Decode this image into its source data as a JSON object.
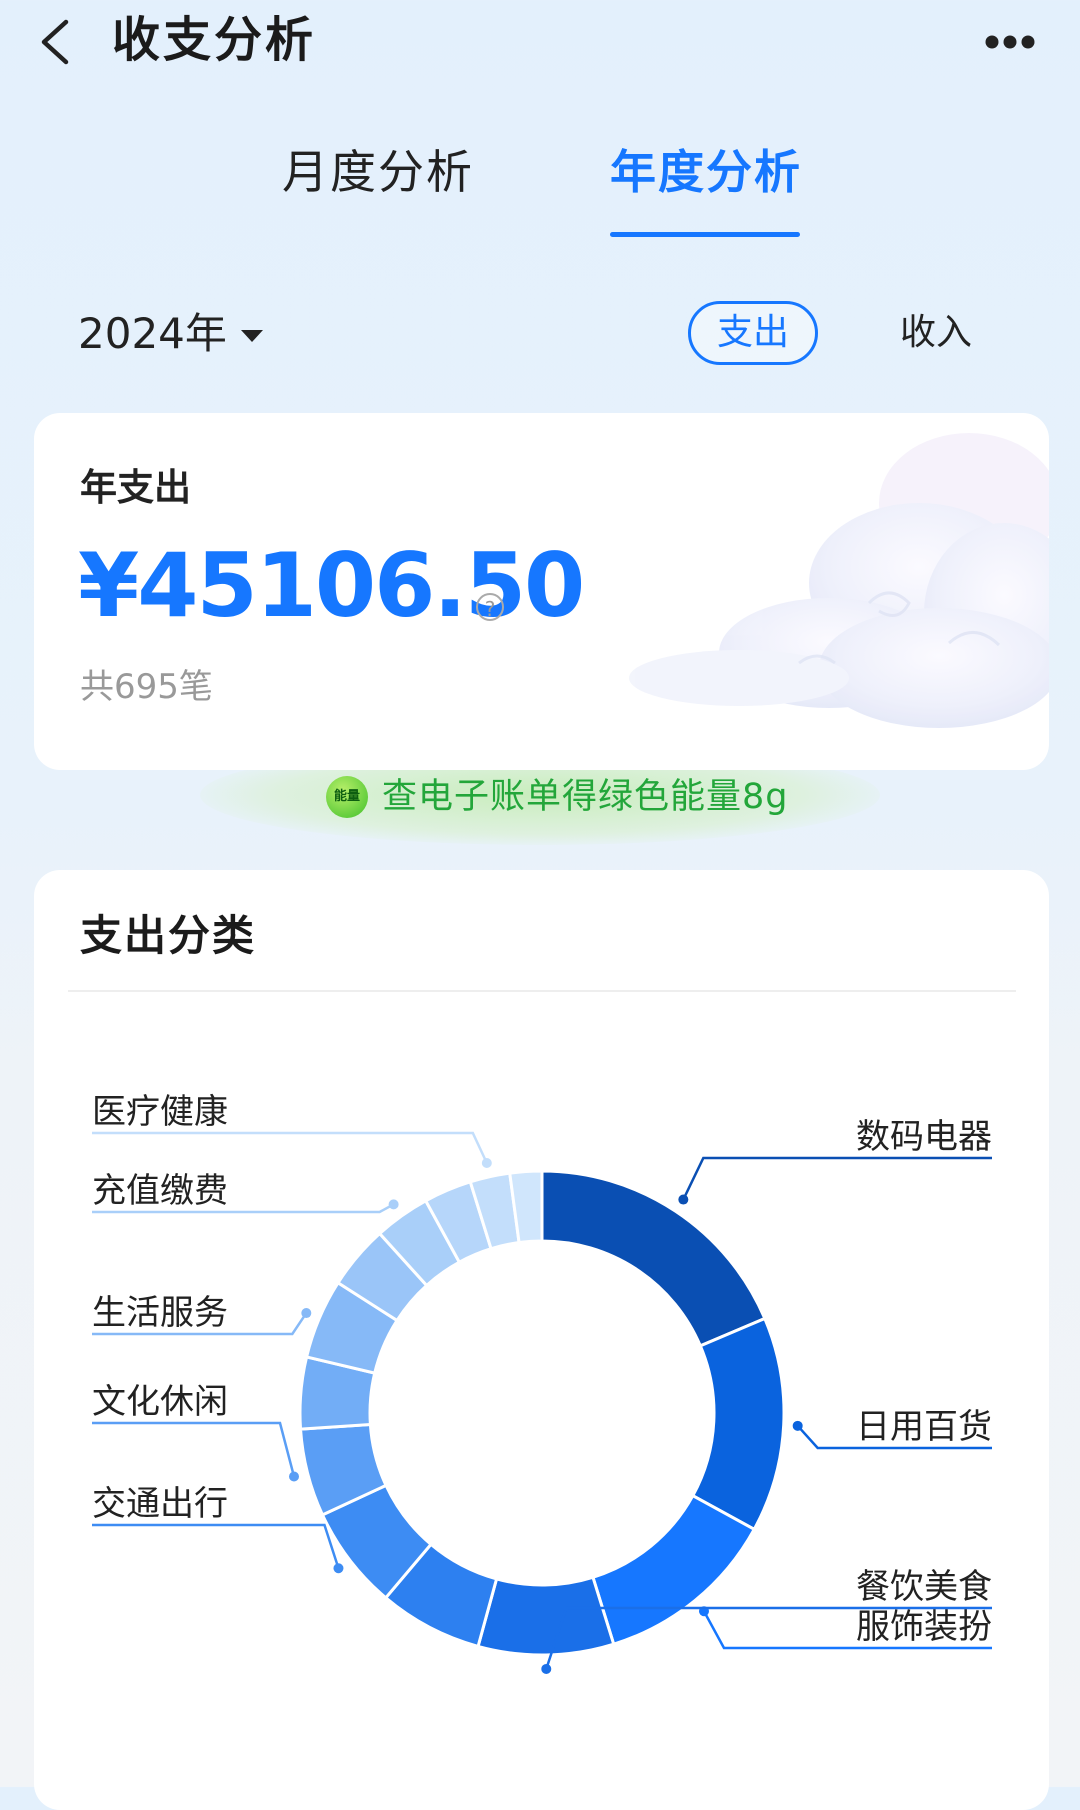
{
  "header": {
    "title": "收支分析",
    "back_icon": "chevron-left-icon",
    "more_icon": "more-horizontal-icon"
  },
  "tabs": [
    {
      "label": "月度分析",
      "active": false
    },
    {
      "label": "年度分析",
      "active": true
    }
  ],
  "filter": {
    "year": "2024年",
    "toggle_expense": "支出",
    "toggle_income": "收入",
    "selected": "支出"
  },
  "summary": {
    "label": "年支出",
    "amount": "¥45106.50",
    "help": "?",
    "count": "共695笔"
  },
  "energy_banner": {
    "badge": "能量",
    "text": "查电子账单得绿色能量8g"
  },
  "category_section": {
    "title": "支出分类"
  },
  "colors": {
    "accent": "#1677ff",
    "green": "#23a63a"
  },
  "chart_data": {
    "type": "pie",
    "donut": true,
    "categories": [
      "数码电器",
      "日用百货",
      "服饰装扮",
      "餐饮美食",
      "交通出行",
      "文化休闲",
      "生活服务",
      "充值缴费",
      "医疗健康"
    ],
    "segments": [
      {
        "label": "数码电器",
        "value": 17.5,
        "color": "#0a4fb3"
      },
      {
        "label": "日用百货",
        "value": 13.5,
        "color": "#0a63de"
      },
      {
        "label": "服饰装扮",
        "value": 11.5,
        "color": "#1677ff"
      },
      {
        "label": "餐饮美食",
        "value": 8.5,
        "color": "#1a6fe8"
      },
      {
        "label": "",
        "value": 6.5,
        "color": "#2d80f0"
      },
      {
        "label": "交通出行",
        "value": 6.5,
        "color": "#3d8cf3"
      },
      {
        "label": "文化休闲",
        "value": 5.5,
        "color": "#5a9ef5"
      },
      {
        "label": "",
        "value": 4.5,
        "color": "#72adf6"
      },
      {
        "label": "生活服务",
        "value": 5.0,
        "color": "#86b9f7"
      },
      {
        "label": "",
        "value": 4.0,
        "color": "#9ac5f8"
      },
      {
        "label": "充值缴费",
        "value": 3.5,
        "color": "#a9cff9"
      },
      {
        "label": "",
        "value": 3.0,
        "color": "#b6d6fa"
      },
      {
        "label": "医疗健康",
        "value": 2.5,
        "color": "#c3defb"
      },
      {
        "label": "",
        "value": 2.0,
        "color": "#d0e6fc"
      }
    ]
  }
}
